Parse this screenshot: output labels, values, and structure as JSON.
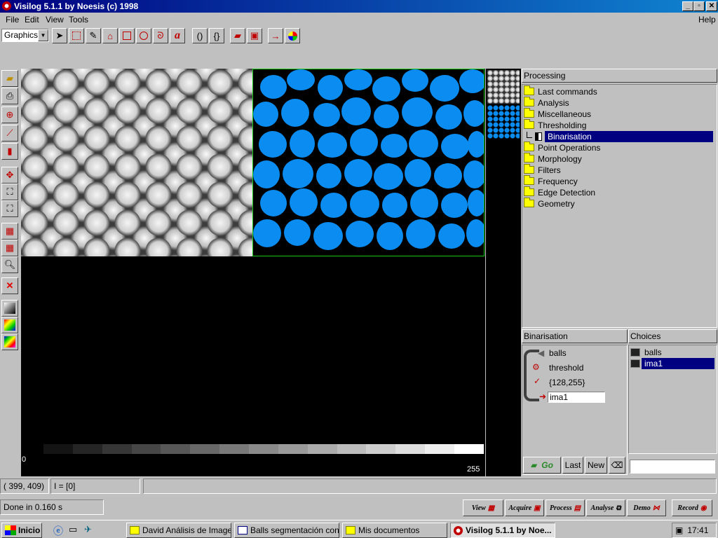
{
  "window": {
    "title": "Visilog 5.1.1 by Noesis (c) 1998",
    "min": "_",
    "max": "▫",
    "close": "✕"
  },
  "menu": {
    "file": "File",
    "edit": "Edit",
    "view": "View",
    "tools": "Tools",
    "help": "Help"
  },
  "toolbar": {
    "mode_select": "Graphics",
    "combo_arrow": "▼"
  },
  "canvas": {
    "scale_min": "0",
    "scale_max": "255"
  },
  "processing": {
    "header": "Processing",
    "items": [
      "Last commands",
      "Analysis",
      "Miscellaneous",
      "Thresholding"
    ],
    "selected": "Binarisation",
    "items_after": [
      "Point Operations",
      "Morphology",
      "Filters",
      "Frequency",
      "Edge Detection",
      "Geometry"
    ]
  },
  "binarisation": {
    "header": "Binarisation",
    "input": "balls",
    "mode": "threshold",
    "range": "{128,255}",
    "output": "ima1"
  },
  "choices": {
    "header": "Choices",
    "items": [
      "balls",
      "ima1"
    ]
  },
  "actions": {
    "go": "Go",
    "last": "Last",
    "new": "New",
    "command_value": ""
  },
  "status": {
    "coords": "( 399, 409)",
    "intensity": "I = [0]",
    "message": "Done in 0.160 s"
  },
  "bottom_buttons": {
    "view": "View",
    "acquire": "Acquire",
    "process": "Process",
    "analyse": "Analyse",
    "demo": "Demo",
    "record": "Record"
  },
  "taskbar": {
    "start": "Inicio",
    "tasks": [
      "David Análisis de Imagen",
      "Balls segmentación con ...",
      "Mis documentos",
      "Visilog 5.1.1 by Noe..."
    ],
    "time": "17:41"
  }
}
